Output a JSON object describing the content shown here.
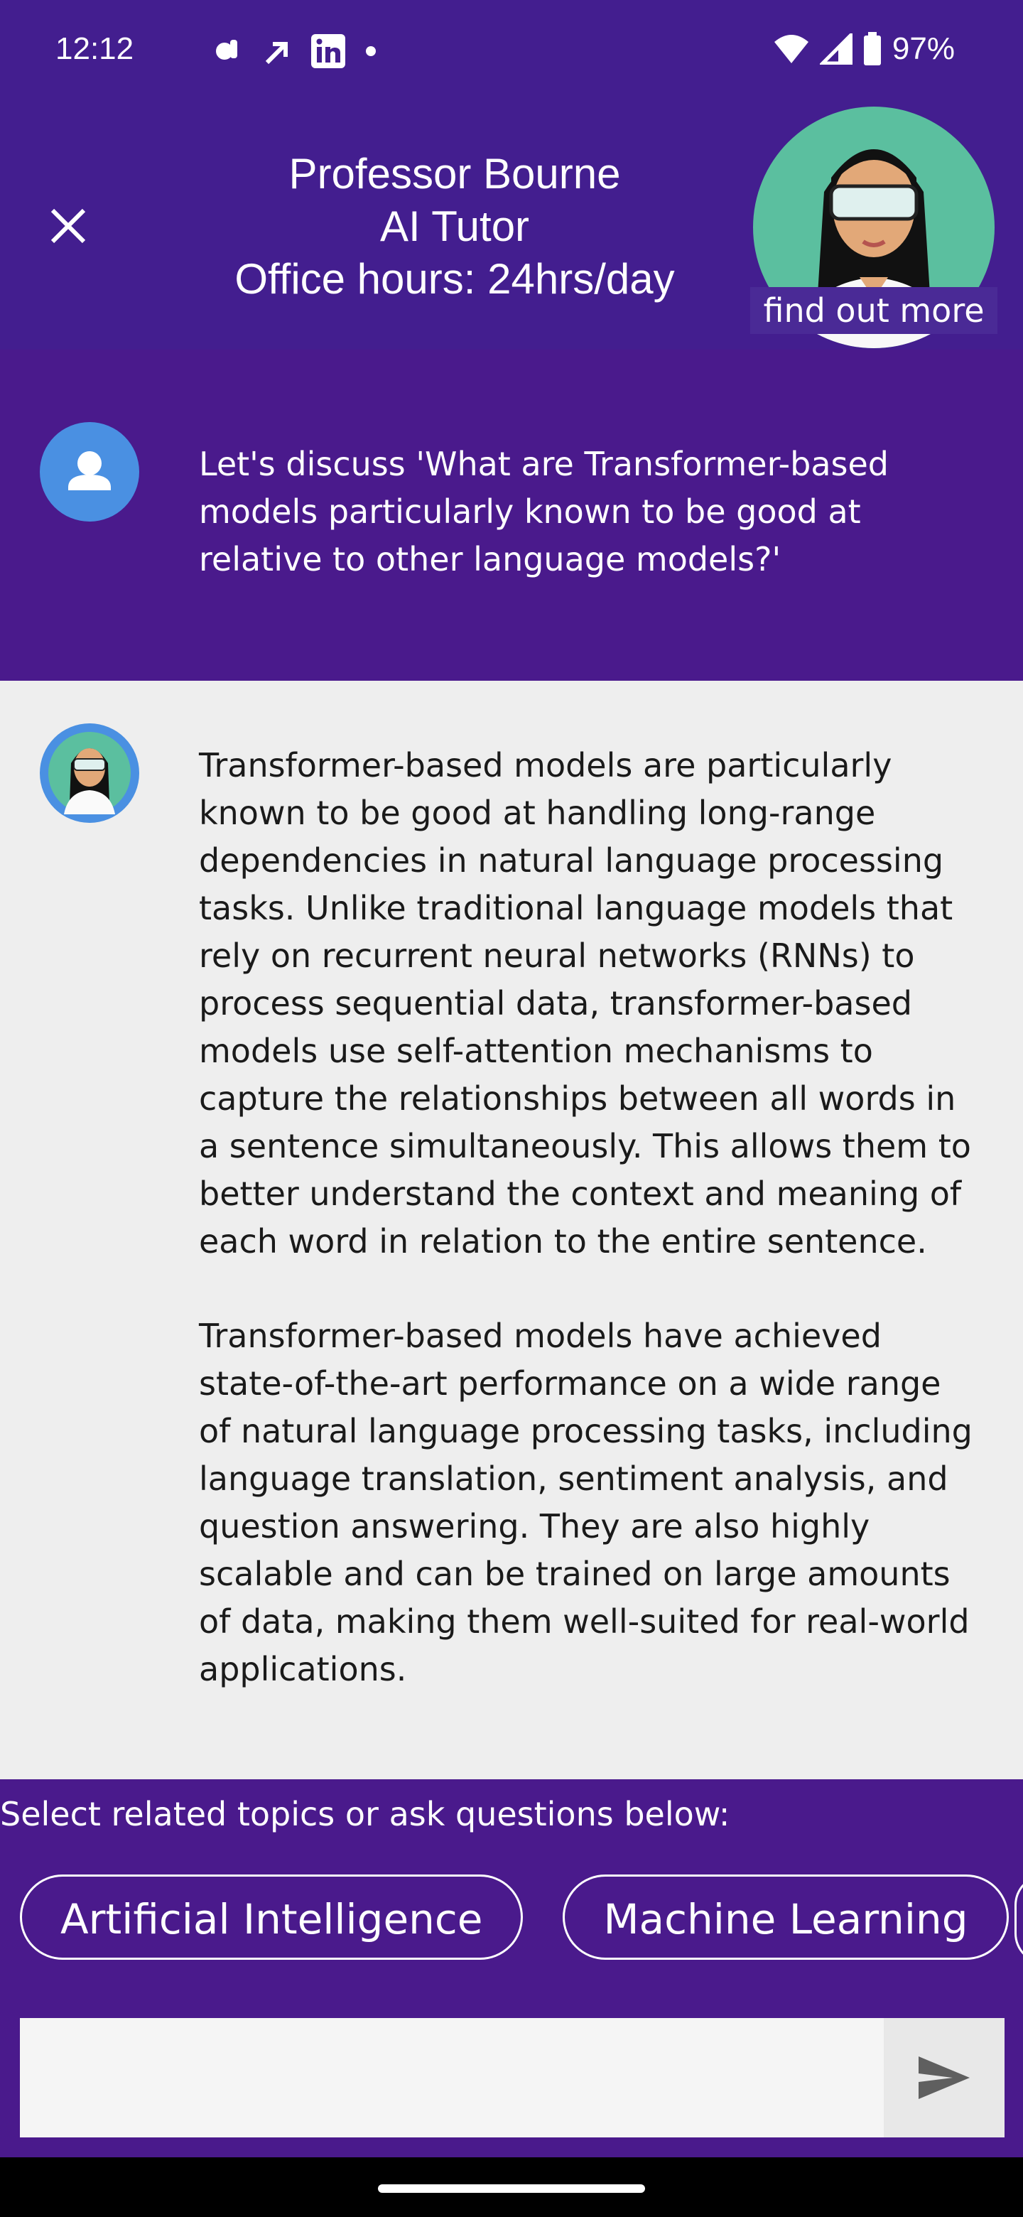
{
  "status_bar": {
    "time": "12:12",
    "notification_icons": [
      "tiktok-icon",
      "arrow-icon",
      "linkedin-icon",
      "dot-icon"
    ],
    "battery": "97%"
  },
  "header": {
    "title_line1": "Professor Bourne",
    "title_line2": "AI Tutor",
    "title_line3": "Office hours: 24hrs/day",
    "find_out_more": "find out more"
  },
  "conversation": {
    "user_message": "Let's discuss 'What are Transformer-based models particularly known to be good at relative to other language models?'",
    "bot_paragraph1": "Transformer-based models are particularly known to be good at handling long-range dependencies in natural language processing tasks. Unlike traditional language models that rely on recurrent neural networks (RNNs) to process sequential data, transformer-based models use self-attention mechanisms to capture the relationships between all words in a sentence simultaneously. This allows them to better understand the context and meaning of each word in relation to the entire sentence.",
    "bot_paragraph2": "Transformer-based models have achieved state-of-the-art performance on a wide range of natural language processing tasks, including language translation, sentiment analysis, and question answering. They are also highly scalable and can be trained on large amounts of data, making them well-suited for real-world applications."
  },
  "suggestions": {
    "label": "Select related topics or ask questions below:",
    "chips": [
      "Artificial Intelligence",
      "Machine Learning"
    ]
  },
  "input": {
    "placeholder": ""
  },
  "colors": {
    "header_bg": "#431e8f",
    "page_bg": "#4a1a8c",
    "bot_bg": "#eeeeee",
    "avatar_blue": "#4a90e2"
  }
}
